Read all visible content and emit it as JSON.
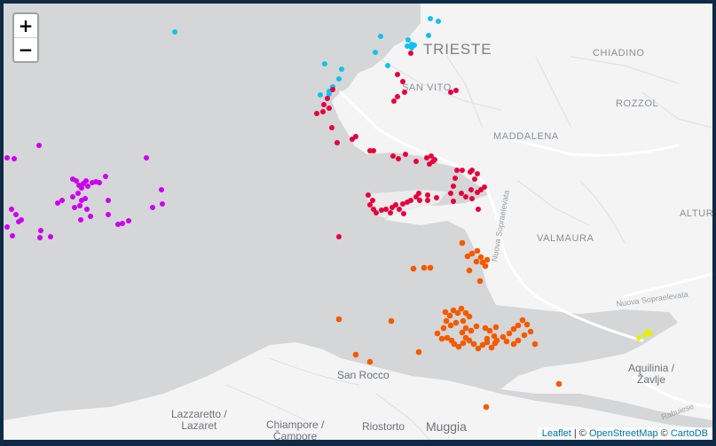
{
  "map": {
    "zoom_in_label": "+",
    "zoom_out_label": "−",
    "attribution": {
      "leaflet": "Leaflet",
      "separator": " | © ",
      "osm": "OpenStreetMap",
      "carto_prefix": " © ",
      "carto": "CartoDB"
    },
    "places": {
      "trieste": "TRIESTE",
      "chiadino": "CHIADINO",
      "san_vito": "SAN VITO",
      "rozzol": "ROZZOL",
      "maddalena": "MADDALENA",
      "altura": "ALTURA",
      "valmaura": "VALMAURA",
      "san_rocco": "San Rocco",
      "aquilinia_1": "Aquilinia /",
      "aquilinia_2": "Žavlje",
      "lazzaretto_1": "Lazzaretto /",
      "lazzaretto_2": "Lazaret",
      "chiampore_1": "Chiampore /",
      "chiampore_2": "Čampore",
      "riostorto": "Riostorto",
      "muggia": "Muggia"
    },
    "roads": {
      "nuova_sopraelevata_1": "Nuova Sopraelevata",
      "nuova_sopraelevata_2": "Nuova Sopraelevata",
      "rabuiese": "Rabuiese"
    },
    "marker_colors": {
      "purple": "#cc00ee",
      "cyan": "#11c2ee",
      "crimson": "#e8003c",
      "orange": "#f45a00",
      "yellow": "#e6f000"
    }
  }
}
